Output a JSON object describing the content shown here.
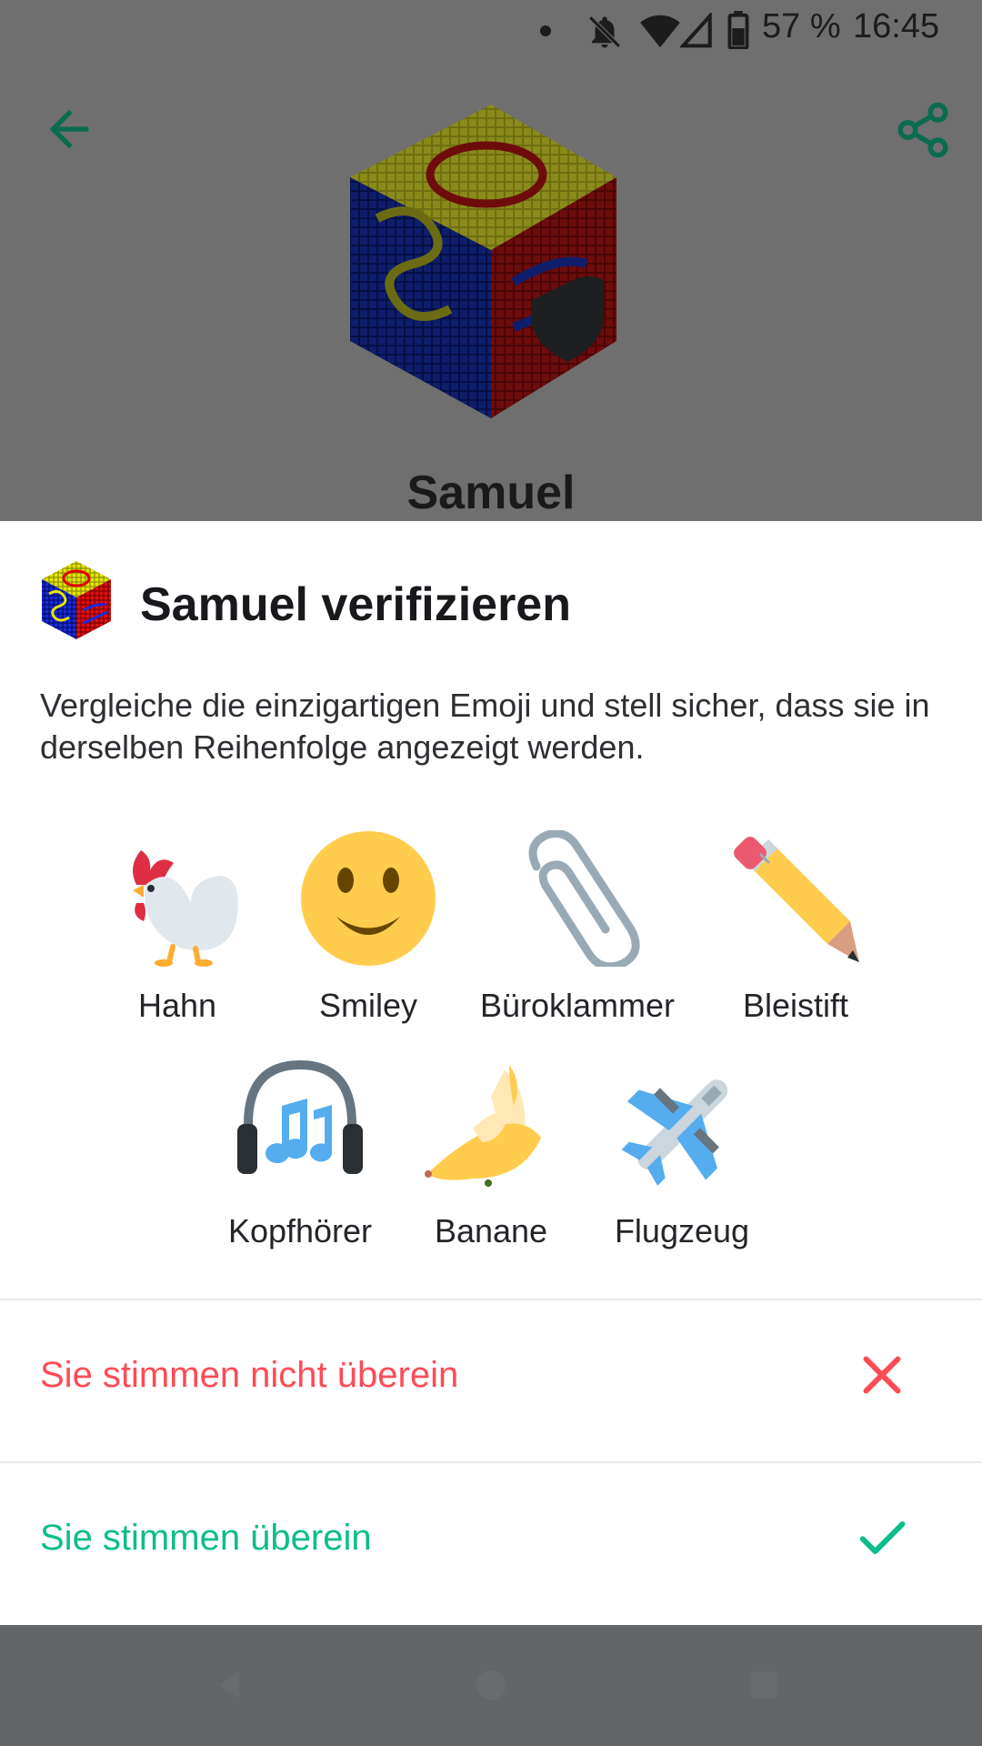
{
  "status_bar": {
    "battery": "57 %",
    "time": "16:45",
    "icons": [
      "dot-icon",
      "notifications-off-icon",
      "wifi-icon",
      "signal-icon",
      "battery-icon"
    ]
  },
  "profile": {
    "name": "Samuel",
    "back_icon": "arrow-left-icon",
    "share_icon": "share-icon",
    "badge_icon": "shield-icon"
  },
  "sheet": {
    "title": "Samuel verifizieren",
    "description": "Vergleiche die einzigartigen Emoji und stell sicher, dass sie in derselben Reihenfolge angezeigt werden.",
    "emojis": [
      {
        "label": "Hahn",
        "icon": "rooster-icon"
      },
      {
        "label": "Smiley",
        "icon": "smiley-icon"
      },
      {
        "label": "Büroklammer",
        "icon": "paperclip-icon"
      },
      {
        "label": "Bleistift",
        "icon": "pencil-icon"
      },
      {
        "label": "Kopfhörer",
        "icon": "headphones-icon"
      },
      {
        "label": "Banane",
        "icon": "banana-icon"
      },
      {
        "label": "Flugzeug",
        "icon": "airplane-icon"
      }
    ],
    "actions": {
      "mismatch_label": "Sie stimmen nicht überein",
      "match_label": "Sie stimmen überein"
    }
  },
  "colors": {
    "accent": "#0dbd8b",
    "danger": "#ff4b55",
    "scrim": "#6f6f6f"
  }
}
